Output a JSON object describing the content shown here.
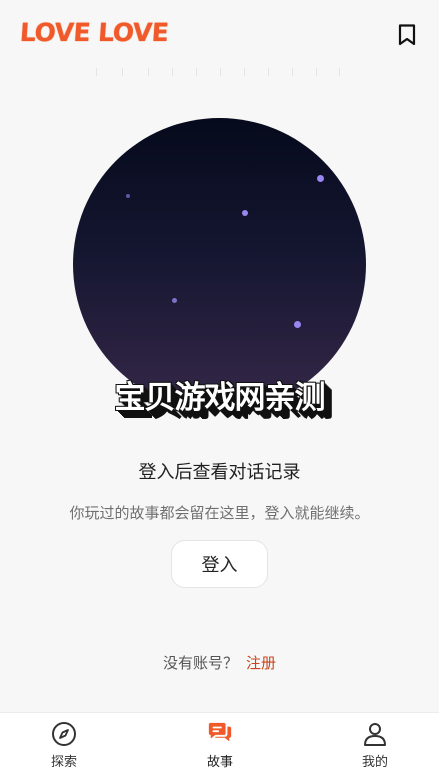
{
  "header": {
    "logo": "LOVE LOVE",
    "bookmark_icon": "bookmark-icon"
  },
  "hero": {
    "watermark": "宝贝游戏网亲测"
  },
  "main": {
    "title": "登入后查看对话记录",
    "subtitle": "你玩过的故事都会留在这里，登入就能继续。",
    "login_label": "登入",
    "signup_prompt": "没有账号？",
    "signup_link": "注册"
  },
  "nav": {
    "items": [
      {
        "label": "探索",
        "icon": "compass-icon",
        "active": false
      },
      {
        "label": "故事",
        "icon": "chat-bubbles-icon",
        "active": true
      },
      {
        "label": "我的",
        "icon": "person-icon",
        "active": false
      }
    ]
  },
  "colors": {
    "brand": "#f05a2a",
    "link": "#c6461c",
    "hero_top": "#060a1c",
    "hero_bottom": "#352748",
    "star": "#9a86f0"
  }
}
